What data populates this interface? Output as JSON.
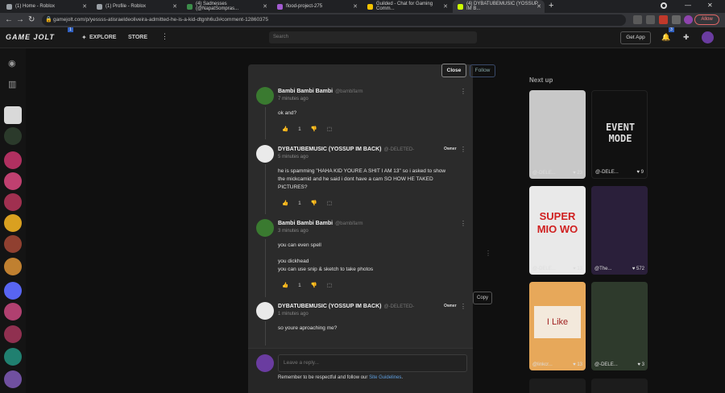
{
  "tabs": [
    {
      "title": "(1) Home - Roblox"
    },
    {
      "title": "(1) Profile - Roblox"
    },
    {
      "title": "(4) Sadnesses (@NapatSompras..."
    },
    {
      "title": "flood-project-275"
    },
    {
      "title": "Guilded - Chat for Gaming Comm..."
    },
    {
      "title": "(4) DYBATUBEMUSIC (YOSSUP IM B..."
    }
  ],
  "address": {
    "url": "gamejolt.com/p/yessss-atisraeldeoliveira-admitted-he-is-a-kid-dtgnh6u3#comment-12860375"
  },
  "browser": {
    "allow_label": "Allow"
  },
  "site": {
    "logo": "GAME JOLT",
    "notif_badge": "1",
    "nav": {
      "explore": "EXPLORE",
      "store": "STORE"
    },
    "search_placeholder": "Search",
    "get_app": "Get App",
    "bell_badge": "3"
  },
  "modal": {
    "close_label": "Close",
    "follow_label": "Follow",
    "comments": [
      {
        "author": "Bambi Bambi Bambi",
        "handle": "@bambifarm",
        "time": "7 minutes ago",
        "lines": [
          "ok and?"
        ],
        "likes": "1",
        "owner": ""
      },
      {
        "author": "DYBATUBEMUSIC (YOSSUP IM BACK)",
        "handle": "@-DELETED-",
        "time": "5 minutes ago",
        "lines": [
          "he is spamming \"HAHA KID YOURE A SHIT I AM 13\" so i asked to show",
          "the mickcamid and he said i dont have a cam SO HOW HE TAKED",
          "PICTURES?"
        ],
        "likes": "1",
        "owner": "Owner"
      },
      {
        "author": "Bambi Bambi Bambi",
        "handle": "@bambifarm",
        "time": "3 minutes ago",
        "lines": [
          "you can even spell",
          "",
          "you dickhead",
          "you can use snip & sketch to take photos"
        ],
        "likes": "1",
        "owner": ""
      },
      {
        "author": "DYBATUBEMUSIC (YOSSUP IM BACK)",
        "handle": "@-DELETED-",
        "time": "1 minutes ago",
        "lines": [
          "so youre aproaching me?"
        ],
        "likes": "",
        "owner": "Owner"
      }
    ],
    "reply_placeholder": "Leave a reply...",
    "guideline_prefix": "Remember to be respectful and follow our ",
    "guideline_link": "Site Guidelines",
    "guideline_suffix": "."
  },
  "next_up": {
    "title": "Next up",
    "items": [
      {
        "user": "@-DELE...",
        "likes": "23",
        "caption": ""
      },
      {
        "user": "@-DELE...",
        "likes": "9",
        "caption": "EVENT MODE"
      },
      {
        "user": "@-DELE...",
        "likes": "13",
        "caption": "SUPER MIO WO"
      },
      {
        "user": "@The...",
        "likes": "572",
        "caption": ""
      },
      {
        "user": "@linkcr...",
        "likes": "13",
        "caption": "I Like"
      },
      {
        "user": "@-DELE...",
        "likes": "3",
        "caption": ""
      }
    ]
  },
  "misc": {
    "copy_label": "Copy"
  },
  "colors": {
    "accent_link": "#5f9fe0",
    "allow_red": "#e06666",
    "modal_bg": "#2b2b2b"
  }
}
